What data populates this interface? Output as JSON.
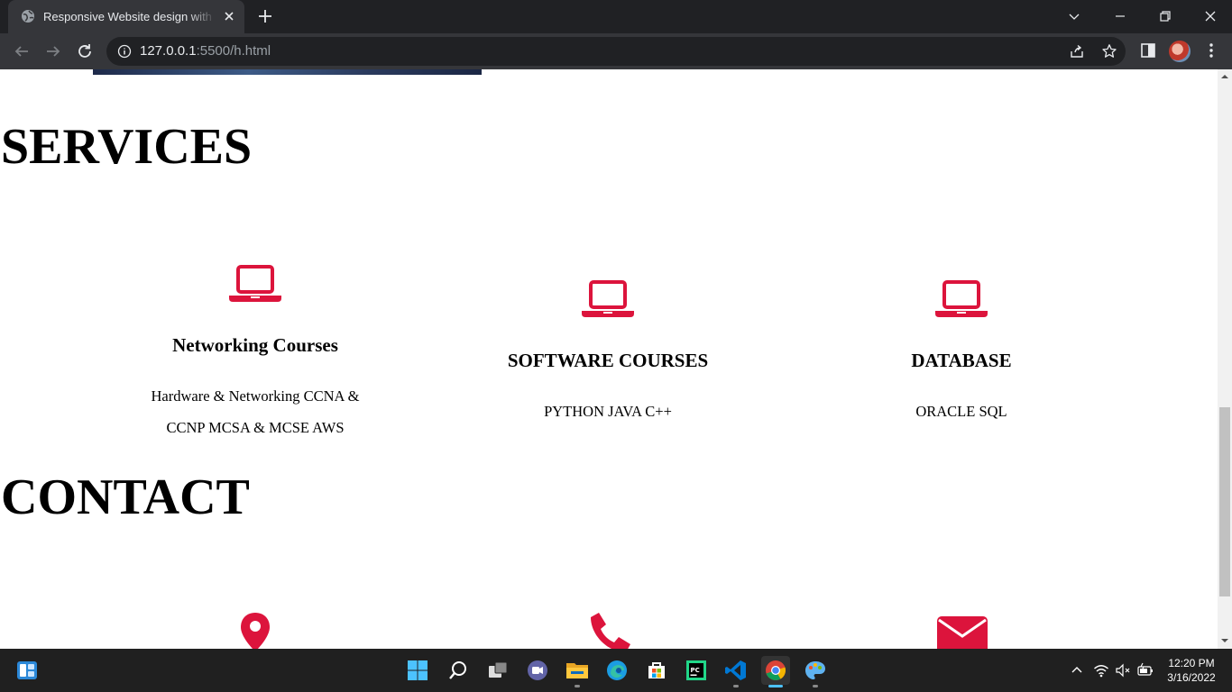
{
  "browser": {
    "tab_title": "Responsive Website design with HTML",
    "url_host": "127.0.0.1",
    "url_rest": ":5500/h.html"
  },
  "page": {
    "services_title": "SERVICES",
    "contact_title": "CONTACT",
    "accent_color": "#dc143c",
    "services": [
      {
        "icon": "laptop-icon",
        "heading": "Networking Courses",
        "lines": [
          "Hardware & Networking CCNA &",
          "CCNP MCSA & MCSE AWS"
        ]
      },
      {
        "icon": "laptop-icon",
        "heading": "SOFTWARE COURSES",
        "lines": [
          "PYTHON JAVA C++"
        ]
      },
      {
        "icon": "laptop-icon",
        "heading": "DATABASE",
        "lines": [
          "ORACLE SQL"
        ]
      }
    ],
    "contact_icons": [
      "map-marker-icon",
      "phone-icon",
      "envelope-icon"
    ]
  },
  "taskbar": {
    "apps": [
      "windows-start-icon",
      "search-icon",
      "task-view-icon",
      "teams-chat-icon",
      "file-explorer-icon",
      "edge-icon",
      "microsoft-store-icon",
      "pycharm-icon",
      "vscode-icon",
      "chrome-icon",
      "paint-icon"
    ],
    "time": "12:20 PM",
    "date": "3/16/2022"
  }
}
